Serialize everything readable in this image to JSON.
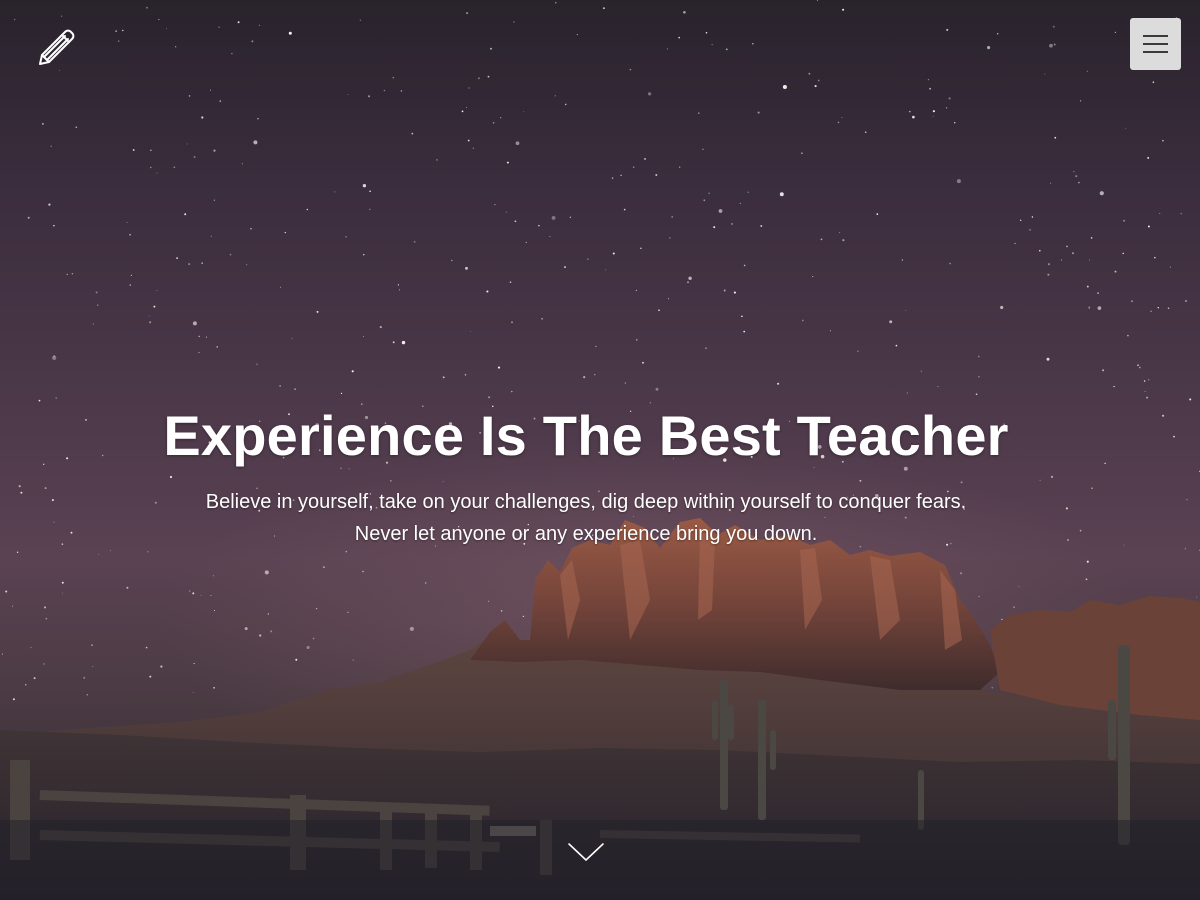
{
  "header": {
    "logo_icon": "pencil-icon",
    "menu_icon": "hamburger-menu-icon",
    "menu_button_color": "#dcdcdc"
  },
  "hero": {
    "title": "Experience Is The Best Teacher",
    "subtitle_line1": "Believe in yourself, take on your challenges, dig deep within yourself to conquer fears.",
    "subtitle_line2": "Never let anyone or any experience bring you down.",
    "scroll_icon": "chevron-down-icon",
    "text_color": "#ffffff"
  }
}
